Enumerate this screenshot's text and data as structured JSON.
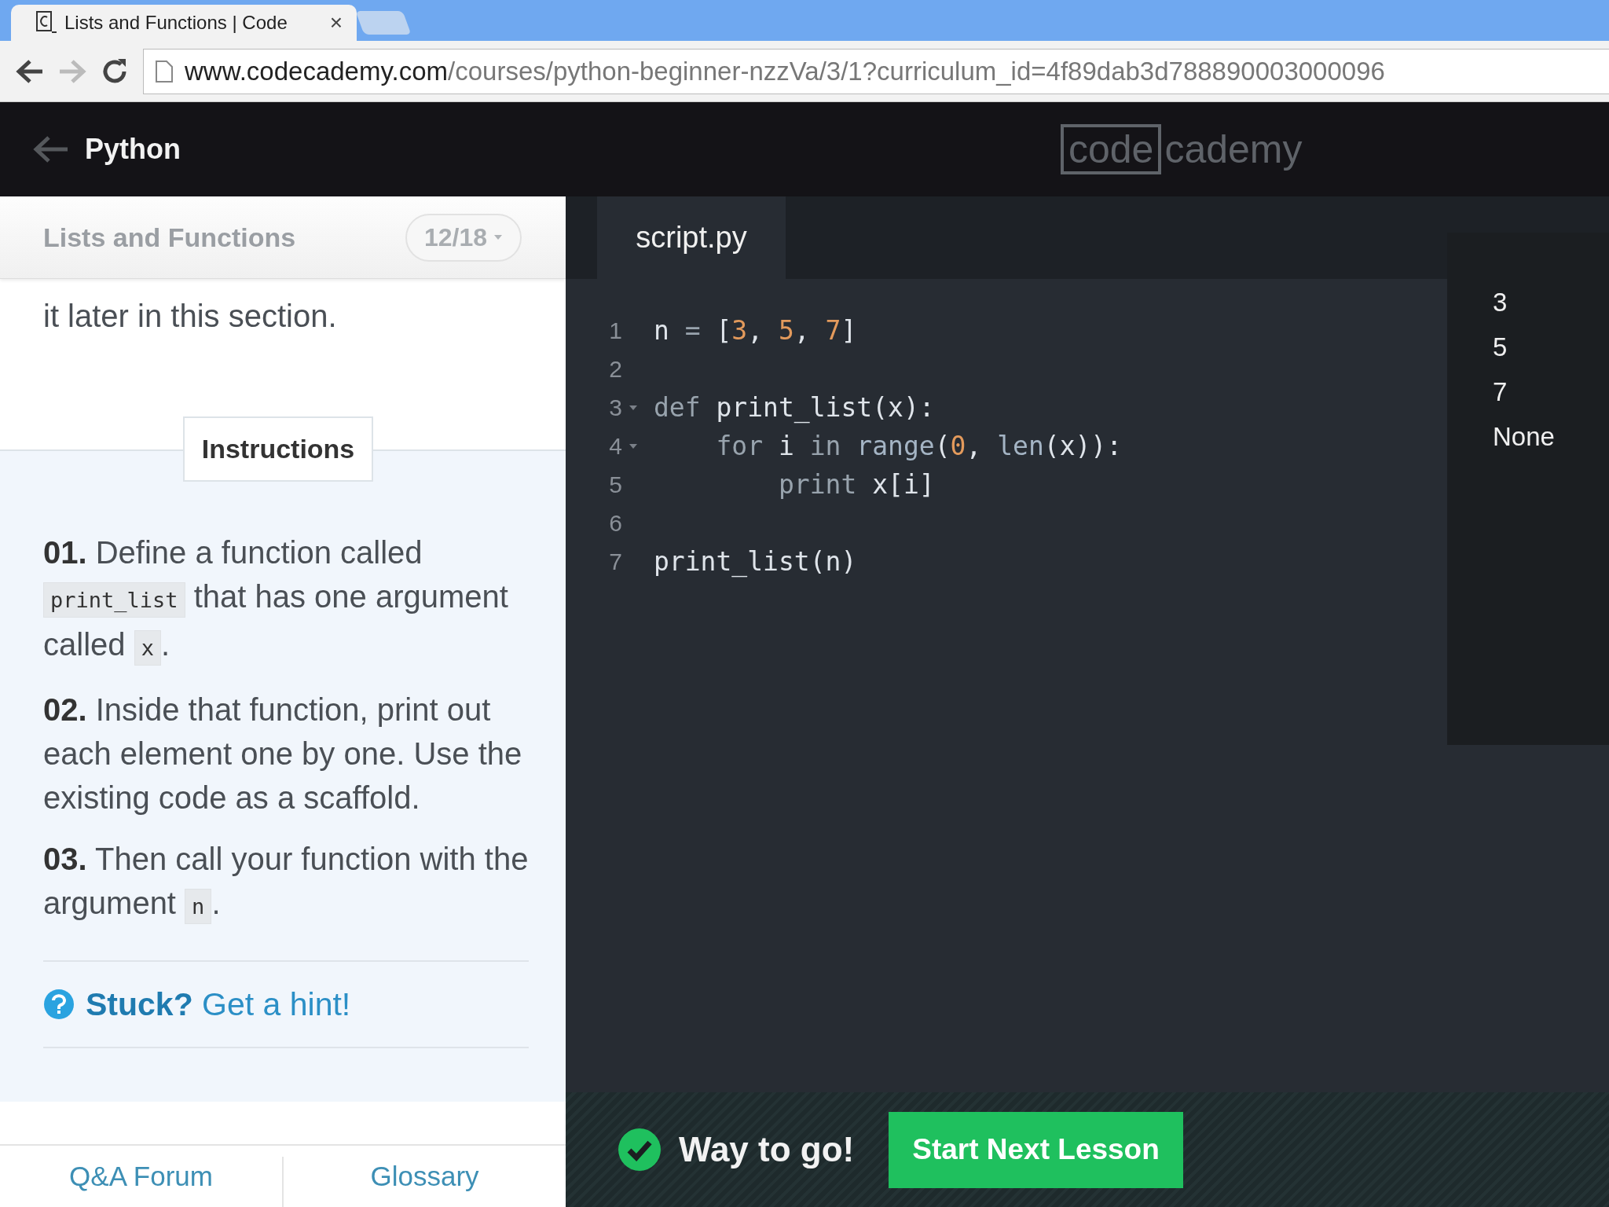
{
  "browser": {
    "tab": {
      "title": "Lists and Functions | Code",
      "close": "×",
      "selected": true
    },
    "address": {
      "domain": "www.codecademy.com",
      "path": "/courses/python-beginner-nzzVa/3/1?curriculum_id=4f89dab3d788890003000096"
    },
    "forward_disabled": true
  },
  "header": {
    "back_label": "Python",
    "logo": {
      "boxed": "code",
      "rest": "cademy"
    }
  },
  "lesson": {
    "title": "Lists and Functions",
    "progress": "12/18",
    "intro": "it later in this section.",
    "instructions_tab": "Instructions",
    "steps": [
      {
        "number": "01.",
        "parts": [
          {
            "kind": "text",
            "text": "Define a function called "
          },
          {
            "kind": "code",
            "text": "print_list"
          },
          {
            "kind": "text",
            "text": " that has one argument called "
          },
          {
            "kind": "code",
            "text": "x"
          },
          {
            "kind": "text",
            "text": "."
          }
        ]
      },
      {
        "number": "02.",
        "parts": [
          {
            "kind": "text",
            "text": "Inside that function, print out each element one by one. Use the existing code as a scaffold."
          }
        ]
      },
      {
        "number": "03.",
        "parts": [
          {
            "kind": "text",
            "text": "Then call your function with the argument "
          },
          {
            "kind": "code",
            "text": "n"
          },
          {
            "kind": "text",
            "text": "."
          }
        ]
      }
    ],
    "hint": "**Stuck?** Get a hint!",
    "footer_links": [
      "Q&A Forum",
      "Glossary"
    ]
  },
  "editor": {
    "tab": "script.py",
    "lines": [
      {
        "number": "1",
        "fold": false,
        "tokens": [
          {
            "kind": "plain",
            "text": "n"
          },
          {
            "kind": "keyword",
            "text": " = "
          },
          {
            "kind": "plain",
            "text": "["
          },
          {
            "kind": "number",
            "text": "3"
          },
          {
            "kind": "plain",
            "text": ", "
          },
          {
            "kind": "number",
            "text": "5"
          },
          {
            "kind": "plain",
            "text": ", "
          },
          {
            "kind": "number",
            "text": "7"
          },
          {
            "kind": "plain",
            "text": "]"
          }
        ]
      },
      {
        "number": "2",
        "fold": false
      },
      {
        "number": "3",
        "fold": true,
        "tokens": [
          {
            "kind": "keyword",
            "text": "def "
          },
          {
            "kind": "plain",
            "text": "print_list(x):"
          }
        ]
      },
      {
        "number": "4",
        "fold": true,
        "tokens": [
          {
            "kind": "keyword",
            "text": "    for "
          },
          {
            "kind": "plain",
            "text": "i "
          },
          {
            "kind": "keyword",
            "text": "in "
          },
          {
            "kind": "builtin",
            "text": "range"
          },
          {
            "kind": "plain",
            "text": "("
          },
          {
            "kind": "number",
            "text": "0"
          },
          {
            "kind": "plain",
            "text": ", "
          },
          {
            "kind": "builtin",
            "text": "len"
          },
          {
            "kind": "plain",
            "text": "(x)):"
          }
        ]
      },
      {
        "number": "5",
        "fold": false,
        "tokens": [
          {
            "kind": "keyword",
            "text": "        print "
          },
          {
            "kind": "plain",
            "text": "x[i]"
          }
        ]
      },
      {
        "number": "6",
        "fold": false
      },
      {
        "number": "7",
        "fold": false,
        "tokens": [
          {
            "kind": "plain",
            "text": "print_list(n)"
          }
        ]
      }
    ],
    "output": [
      "3",
      "5",
      "7",
      "None"
    ]
  },
  "result": {
    "message": "Way to go!",
    "passed": true,
    "button": "Start Next Lesson"
  }
}
